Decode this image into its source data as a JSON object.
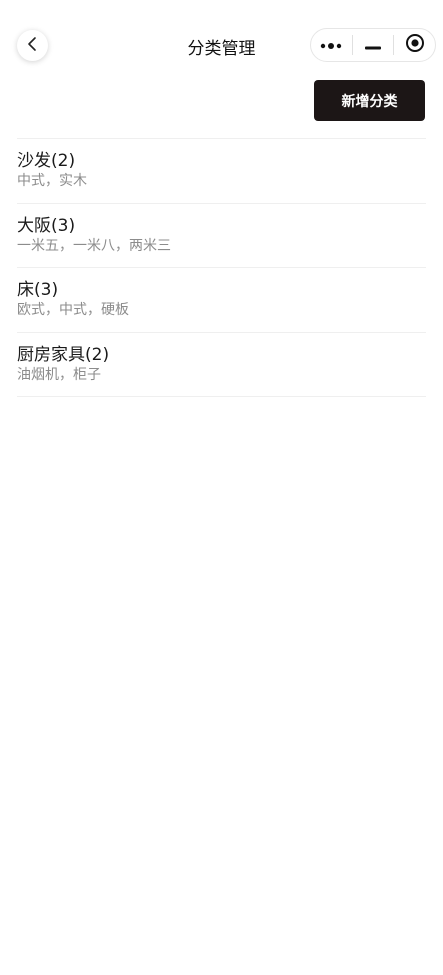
{
  "header": {
    "title": "分类管理",
    "back_icon": "chevron-left-icon",
    "capsule_icons": [
      "more-dots-icon",
      "minimize-icon",
      "close-target-icon"
    ]
  },
  "actions": {
    "add_label": "新增分类"
  },
  "categories": [
    {
      "title": "沙发(2)",
      "sub": "中式，实木"
    },
    {
      "title": "大阪(3)",
      "sub": "一米五，一米八，两米三"
    },
    {
      "title": "床(3)",
      "sub": "欧式，中式，硬板"
    },
    {
      "title": "厨房家具(2)",
      "sub": "油烟机，柜子"
    }
  ],
  "colors": {
    "primary_button": "#1c1616",
    "subtext": "#8c8c8c",
    "divider": "#efefef"
  }
}
